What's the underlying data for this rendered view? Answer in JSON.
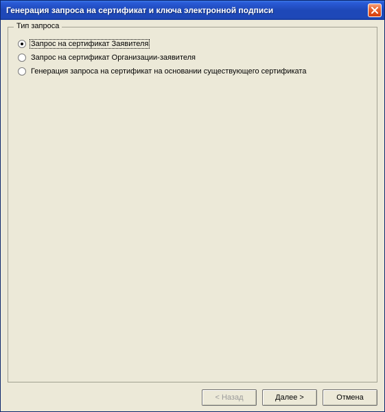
{
  "window": {
    "title": "Генерация запроса на сертификат и ключа электронной подписи"
  },
  "group": {
    "legend": "Тип запроса",
    "options": [
      {
        "label": "Запрос на сертификат Заявителя",
        "selected": true
      },
      {
        "label": "Запрос на сертификат Организации-заявителя",
        "selected": false
      },
      {
        "label": "Генерация запроса на сертификат на основании существующего сертификата",
        "selected": false
      }
    ]
  },
  "buttons": {
    "back": {
      "label": "< Назад",
      "enabled": false
    },
    "next": {
      "label": "Далее >",
      "enabled": true
    },
    "cancel": {
      "label": "Отмена",
      "enabled": true
    }
  }
}
